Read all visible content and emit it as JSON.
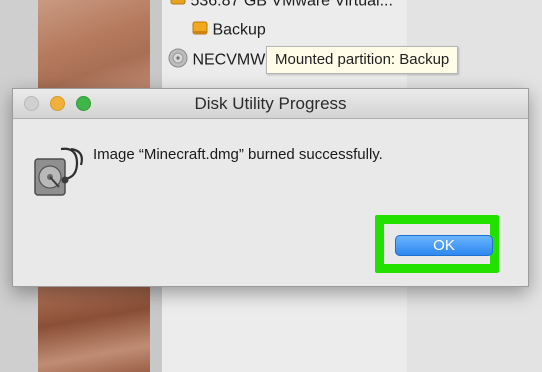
{
  "sidebar": {
    "volume_label": "536.87 GB VMware Virtual...",
    "backup_label": "Backup",
    "nec_label": "NECVMW"
  },
  "tooltip": {
    "text": "Mounted partition: Backup"
  },
  "dialog": {
    "title": "Disk Utility Progress",
    "message": "Image “Minecraft.dmg” burned successfully.",
    "ok_label": "OK",
    "highlight_color": "#22e000",
    "button_color": "#2a86f0"
  },
  "icons": {
    "drive": "hard-drive-icon",
    "disc": "disc-icon",
    "disk_utility": "disk-utility-icon"
  }
}
